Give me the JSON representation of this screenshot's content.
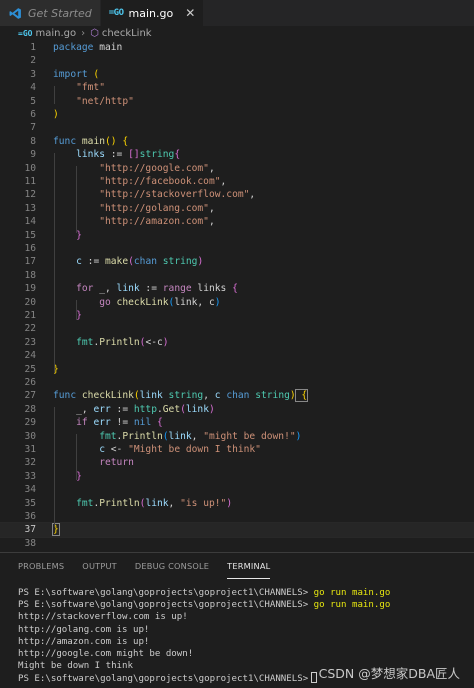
{
  "tabs": [
    {
      "label": "Get Started",
      "icon": "vscode-logo-icon",
      "active": false
    },
    {
      "label": "main.go",
      "icon": "go-file-icon",
      "active": true,
      "close": "✕"
    }
  ],
  "breadcrumb": {
    "file": "main.go",
    "symbol": "checkLink"
  },
  "editor": {
    "current_line": 37,
    "line_numbers": [
      "1",
      "2",
      "3",
      "4",
      "5",
      "6",
      "7",
      "8",
      "9",
      "10",
      "11",
      "12",
      "13",
      "14",
      "15",
      "16",
      "17",
      "18",
      "19",
      "20",
      "21",
      "22",
      "23",
      "24",
      "25",
      "26",
      "27",
      "28",
      "29",
      "30",
      "31",
      "32",
      "33",
      "34",
      "35",
      "36",
      "37",
      "38"
    ],
    "code": {
      "l1": [
        "package",
        " main"
      ],
      "l3": [
        "import",
        " ("
      ],
      "l4": "\"fmt\"",
      "l5": "\"net/http\"",
      "l6": ")",
      "l8": [
        "func",
        "main",
        "()",
        " {"
      ],
      "l9": [
        "links",
        " := ",
        "[]",
        "string",
        "{"
      ],
      "l10": "\"http://google.com\"",
      "l11": "\"http://facebook.com\"",
      "l12": "\"http://stackoverflow.com\"",
      "l13": "\"http://golang.com\"",
      "l14": "\"http://amazon.com\"",
      "l15": "}",
      "l17": [
        "c",
        " := ",
        "make",
        "(",
        "chan",
        " string",
        ")"
      ],
      "l19": [
        "for",
        " _, ",
        "link",
        " := ",
        "range",
        " links ",
        "{"
      ],
      "l20": [
        "go",
        " checkLink",
        "(",
        "link, c",
        ")"
      ],
      "l21": "}",
      "l23": [
        "fmt",
        ".",
        "Println",
        "(",
        "<-c",
        ")"
      ],
      "l25": "}",
      "l27": [
        "func",
        "checkLink",
        "(",
        "link",
        " string",
        ", ",
        "c",
        " chan",
        " string",
        ")",
        " {"
      ],
      "l28": [
        "_, ",
        "err",
        " := ",
        "http",
        ".",
        "Get",
        "(",
        "link",
        ")"
      ],
      "l29": [
        "if",
        " err",
        " != ",
        "nil",
        " {"
      ],
      "l30": [
        "fmt",
        ".",
        "Println",
        "(",
        "link",
        ", ",
        "\"might be down!\"",
        ")"
      ],
      "l31": [
        "c",
        " <- ",
        "\"Might be down I think\""
      ],
      "l32": "return",
      "l33": "}",
      "l35": [
        "fmt",
        ".",
        "Println",
        "(",
        "link",
        ", ",
        "\"is up!\"",
        ")"
      ],
      "l37": "}"
    }
  },
  "panel": {
    "tabs": [
      "PROBLEMS",
      "OUTPUT",
      "DEBUG CONSOLE",
      "TERMINAL"
    ],
    "active_tab": "TERMINAL",
    "terminal": {
      "prompt": "PS E:\\software\\golang\\goprojects\\goproject1\\CHANNELS>",
      "command": "go run main.go",
      "output": [
        "http://stackoverflow.com is up!",
        "http://golang.com is up!",
        "http://amazon.com is up!",
        "http://google.com might be down!",
        "Might be down I think"
      ]
    }
  },
  "watermark": "CSDN @梦想家DBA匠人",
  "colors": {
    "background": "#1e1e1e",
    "keyword": "#569cd6",
    "control_keyword": "#c586c0",
    "string": "#ce9178",
    "function": "#dcdcaa",
    "variable": "#9cdcfe",
    "type": "#4ec9b0",
    "terminal_command": "#e5e510"
  }
}
